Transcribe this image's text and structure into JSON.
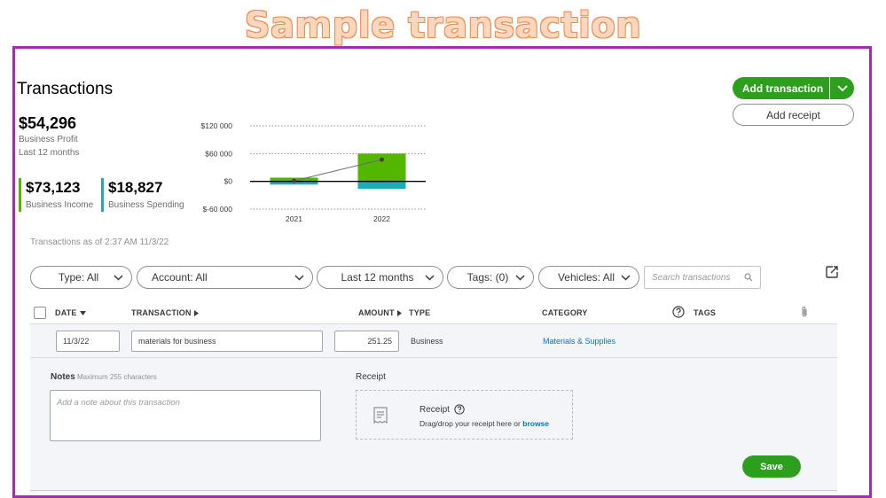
{
  "banner": {
    "title": "Sample transaction"
  },
  "page": {
    "title": "Transactions"
  },
  "header_actions": {
    "add_transaction": "Add transaction",
    "add_receipt": "Add receipt"
  },
  "summary": {
    "profit": {
      "value": "$54,296",
      "label": "Business Profit",
      "period": "Last 12 months"
    },
    "income": {
      "value": "$73,123",
      "label": "Business Income",
      "color": "#53b700"
    },
    "spending": {
      "value": "$18,827",
      "label": "Business Spending",
      "color": "#21abb9"
    }
  },
  "chart_data": {
    "type": "bar",
    "categories": [
      "2021",
      "2022"
    ],
    "series": [
      {
        "values": [
          8000,
          60000
        ],
        "color": "#53b700"
      },
      {
        "values": [
          -7000,
          -16000
        ],
        "color": "#21abb9"
      }
    ],
    "profit_line": [
      1000,
      47000
    ],
    "y_ticks": [
      120000,
      60000,
      0,
      -60000
    ],
    "y_tick_labels": [
      "$120 000",
      "$60 000",
      "$0",
      "$-60 000"
    ],
    "ylim": [
      -60000,
      120000
    ],
    "grid": true
  },
  "as_of": "Transactions as of 2:37 AM 11/3/22",
  "filters": [
    {
      "label": "Type: All"
    },
    {
      "label": "Account: All"
    },
    {
      "label": "Last 12 months"
    },
    {
      "label": "Tags: (0)"
    },
    {
      "label": "Vehicles: All"
    }
  ],
  "search": {
    "placeholder": "Search transactions"
  },
  "table": {
    "columns": {
      "date": "DATE",
      "transaction": "TRANSACTION",
      "amount": "AMOUNT",
      "type": "TYPE",
      "category": "CATEGORY",
      "tags": "TAGS"
    },
    "row": {
      "date": "11/3/22",
      "transaction": "materials for business",
      "amount": "251.25",
      "type": "Business",
      "category": "Materials & Supplies"
    }
  },
  "notes": {
    "label": "Notes",
    "hint": "Maximum 255 characters",
    "placeholder": "Add a note about this transaction"
  },
  "receipt": {
    "label": "Receipt",
    "title": "Receipt",
    "hint": "Drag/drop your receipt here or",
    "browse": "browse"
  },
  "save_label": "Save"
}
